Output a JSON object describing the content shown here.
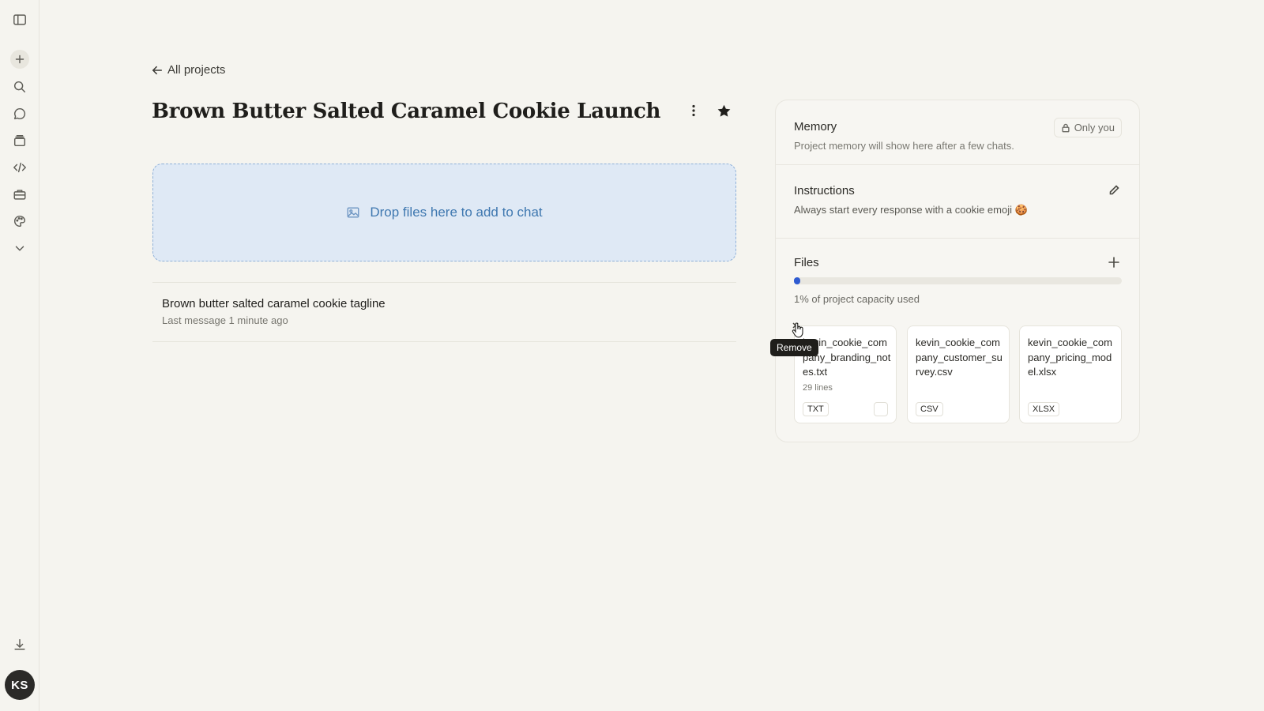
{
  "sidebar": {
    "icons": [
      "sidebar-toggle-icon",
      "new-chat-icon",
      "search-icon",
      "chats-icon",
      "projects-icon",
      "code-icon",
      "toolbox-icon",
      "palette-icon",
      "chevron-down-icon",
      "download-icon"
    ],
    "avatar_initials": "KS"
  },
  "header": {
    "back_label": "All projects",
    "title": "Brown Butter Salted Caramel Cookie Launch",
    "starred": true
  },
  "dropzone": {
    "label": "Drop files here to add to chat"
  },
  "chats": [
    {
      "title": "Brown butter salted caramel cookie tagline",
      "subtitle": "Last message 1 minute ago"
    }
  ],
  "panel": {
    "memory": {
      "title": "Memory",
      "badge": "Only you",
      "subtitle": "Project memory will show here after a few chats."
    },
    "instructions": {
      "title": "Instructions",
      "text": "Always start every response with a cookie emoji 🍪"
    },
    "files": {
      "title": "Files",
      "capacity_percent": 1,
      "capacity_label": "1% of project capacity used",
      "items": [
        {
          "name": "kevin_cookie_company_branding_notes.txt",
          "lines": "29 lines",
          "type": "TXT"
        },
        {
          "name": "kevin_cookie_company_customer_survey.csv",
          "lines": "",
          "type": "CSV"
        },
        {
          "name": "kevin_cookie_company_pricing_model.xlsx",
          "lines": "",
          "type": "XLSX"
        }
      ],
      "remove_tooltip": "Remove"
    }
  },
  "colors": {
    "background": "#f5f4ef",
    "dropzone_bg": "#dfe9f5",
    "dropzone_text": "#3f78b0",
    "progress_fill": "#2f5bd1"
  }
}
